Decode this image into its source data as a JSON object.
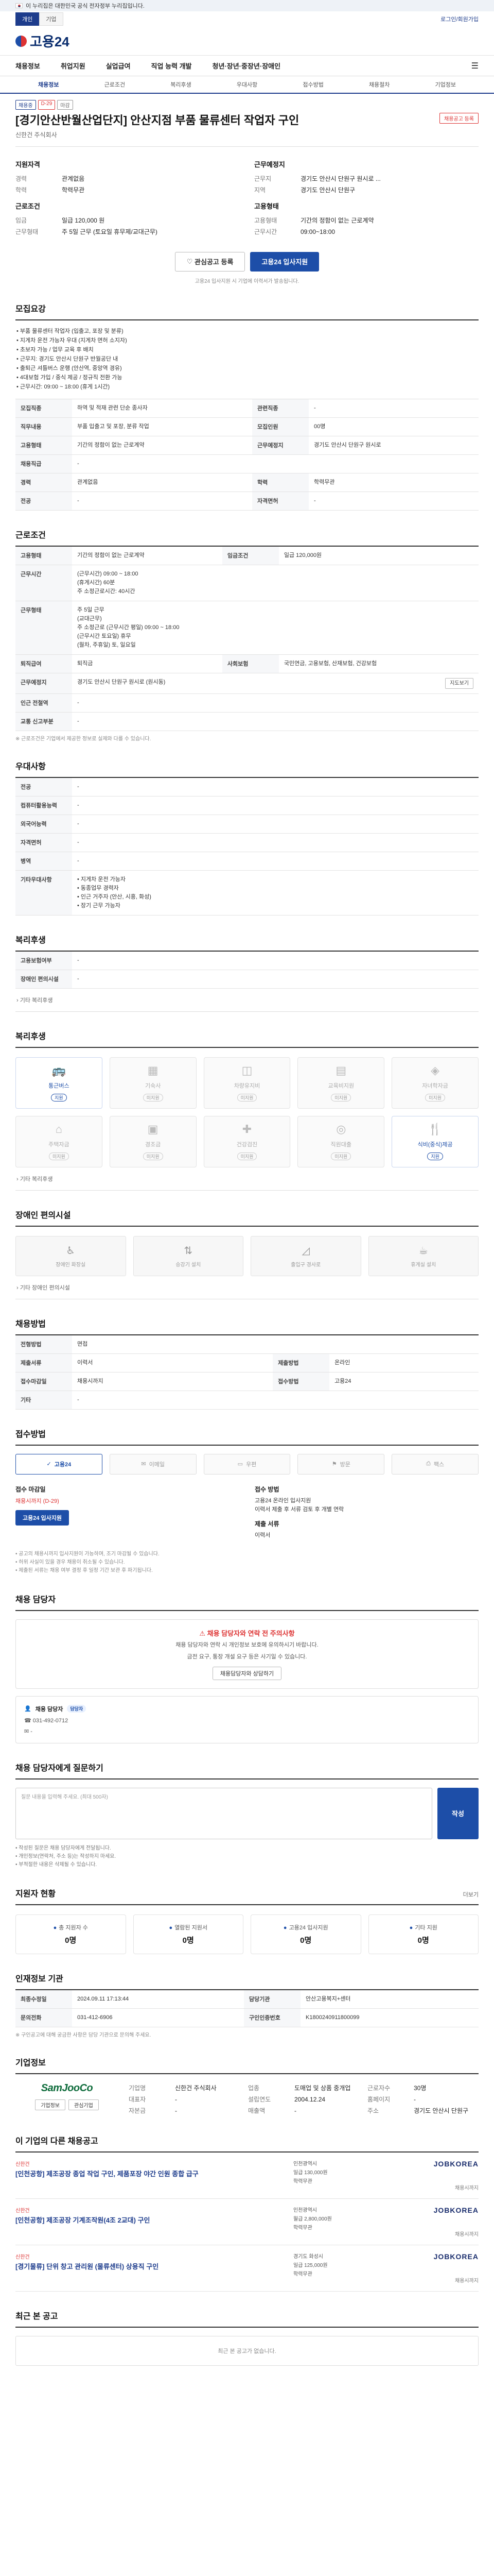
{
  "gov_banner": {
    "text": "이 누리집은 대한민국 공식 전자정부 누리집입니다."
  },
  "top_tabs": [
    "개인",
    "기업"
  ],
  "login_link": "로그인/회원가입",
  "logo_text": "고용24",
  "gnb": [
    "채용정보",
    "취업지원",
    "실업급여",
    "직업 능력 개발",
    "청년·장년·중장년·장애인"
  ],
  "subnav": [
    "채용정보",
    "근로조건",
    "복리후생",
    "우대사항",
    "접수방법",
    "채용절차",
    "기업정보"
  ],
  "job": {
    "tags": [
      "채용중",
      "D-29",
      "마감"
    ],
    "title": "[경기안산반월산업단지] 안산지점 부품 물류센터 작업자 구인",
    "register_btn": "채용공고 등록",
    "company": "신한건 주식회사"
  },
  "summary": {
    "left_title": "지원자격",
    "left": [
      {
        "k": "경력",
        "v": "관계없음"
      },
      {
        "k": "학력",
        "v": "학력무관"
      }
    ],
    "left_title2": "근로조건",
    "left2": [
      {
        "k": "임금",
        "v": "일급 120,000 원"
      },
      {
        "k": "근무형태",
        "v": "주 5일 근무 (토요일 휴무제/교대근무)"
      }
    ],
    "right_title": "근무예정지",
    "right": [
      {
        "k": "근무지",
        "v": "경기도 안산시 단원구 원시로 ..."
      },
      {
        "k": "지역",
        "v": "경기도 안산시 단원구"
      }
    ],
    "right_title2": "고용형태",
    "right2": [
      {
        "k": "고용형태",
        "v": "기간의 정함이 없는 근로계약"
      },
      {
        "k": "근무시간",
        "v": "09:00~18:00"
      }
    ]
  },
  "cta": {
    "scrap": "관심공고 등록",
    "apply": "고용24 입사지원"
  },
  "cta_note": "고용24 입사지원 시 기업에 이력서가 발송됩니다.",
  "recruit": {
    "title": "모집요강",
    "desc_label": "직무내용",
    "desc": "• 부품 물류센터 작업자 (입출고, 포장 및 분류)\n• 지게차 운전 가능자 우대 (지게차 면허 소지자)\n• 초보자 가능 / 업무 교육 후 배치\n• 근무지: 경기도 안산시 단원구 반월공단 내\n• 출퇴근 셔틀버스 운행 (안산역, 중앙역 경유)\n• 4대보험 가입 / 중식 제공 / 정규직 전환 가능\n• 근무시간: 09:00 ~ 18:00 (휴게 1시간)",
    "rows": [
      {
        "k": "모집직종",
        "v": "하역 및 적재 관련 단순 종사자",
        "k2": "관련직종",
        "v2": "-"
      },
      {
        "k": "직무내용",
        "v": "부품 입출고 및 포장, 분류 작업",
        "k2": "모집인원",
        "v2": "00명"
      },
      {
        "k": "고용형태",
        "v": "기간의 정함이 없는 근로계약",
        "k2": "근무예정지",
        "v2": "경기도 안산시 단원구 원시로"
      },
      {
        "k": "채용직급",
        "v": "-",
        "k2": "",
        "v2": ""
      },
      {
        "k": "경력",
        "v": "관계없음",
        "k2": "학력",
        "v2": "학력무관"
      },
      {
        "k": "전공",
        "v": "-",
        "k2": "자격면허",
        "v2": "-"
      }
    ]
  },
  "conditions": {
    "title": "근로조건",
    "rows": [
      {
        "k": "고용형태",
        "v": "기간의 정함이 없는 근로계약",
        "k2": "임금조건",
        "v2": "일급 120,000원"
      },
      {
        "k": "근무시간",
        "v": "(근무시간) 09:00 ~ 18:00\n(휴게시간) 60분\n주 소정근로시간: 40시간",
        "k2": "",
        "v2": ""
      },
      {
        "k": "근무형태",
        "v": "주 5일 근무\n(교대근무)\n주 소정근로 (근무시간 평일) 09:00 ~ 18:00\n(근무시간 토요일) 휴무\n(월차, 주휴일) 토, 일요일",
        "k2": "",
        "v2": ""
      },
      {
        "k": "퇴직급여",
        "v": "퇴직금",
        "k2": "사회보험",
        "v2": "국민연금, 고용보험, 산재보험, 건강보험"
      },
      {
        "k": "근무예정지",
        "v": "경기도 안산시 단원구 원시로 (원시동)",
        "k2": "",
        "v2": ""
      },
      {
        "k": "인근 전철역",
        "v": "-",
        "k2": "",
        "v2": ""
      },
      {
        "k": "교통 신고부분",
        "v": "-",
        "k2": "",
        "v2": ""
      }
    ],
    "map_btn": "지도보기",
    "note": "※ 근로조건은 기업에서 제공한 정보로 실제와 다를 수 있습니다."
  },
  "preferred": {
    "title": "우대사항",
    "rows": [
      {
        "k": "전공",
        "v": "-"
      },
      {
        "k": "컴퓨터활용능력",
        "v": "-"
      },
      {
        "k": "외국어능력",
        "v": "-"
      },
      {
        "k": "자격면허",
        "v": "-"
      },
      {
        "k": "병역",
        "v": "-"
      }
    ],
    "etc_label": "기타우대사항",
    "etc": "• 지게차 운전 가능자\n• 동종업무 경력자\n• 인근 거주자 (안산, 시흥, 화성)\n• 장기 근무 가능자"
  },
  "welfare": {
    "title": "복리후생",
    "rows": [
      {
        "k": "고용보험여부",
        "v": "-"
      },
      {
        "k": "장애인 편의시설",
        "v": "-"
      }
    ],
    "note": "기타 복리후생"
  },
  "insurance": {
    "title": "복리후생",
    "items": [
      {
        "label": "통근버스",
        "on": true
      },
      {
        "label": "기숙사",
        "on": false
      },
      {
        "label": "차량유지비",
        "on": false
      },
      {
        "label": "교육비지원",
        "on": false
      },
      {
        "label": "자녀학자금",
        "on": false
      },
      {
        "label": "주택자금",
        "on": false
      },
      {
        "label": "경조금",
        "on": false
      },
      {
        "label": "건강검진",
        "on": false
      },
      {
        "label": "직원대출",
        "on": false
      },
      {
        "label": "식비(중식)제공",
        "on": true
      }
    ],
    "status_on": "지원",
    "status_off": "미지원",
    "note": "기타 복리후생"
  },
  "disabled": {
    "title": "장애인 편의시설",
    "items": [
      "장애인 화장실",
      "승강기 설치",
      "출입구 경사로",
      "휴게실 설치"
    ],
    "note": "기타 장애인 편의시설"
  },
  "recruit_method": {
    "title": "채용방법",
    "rows": [
      {
        "k": "전형방법",
        "v": "면접",
        "k2": "",
        "v2": ""
      },
      {
        "k": "제출서류",
        "v": "이력서",
        "k2": "제출방법",
        "v2": "온라인"
      },
      {
        "k": "접수마감일",
        "v": "채용시까지",
        "k2": "접수방법",
        "v2": "고용24"
      },
      {
        "k": "기타",
        "v": "-",
        "k2": "",
        "v2": ""
      }
    ]
  },
  "apply": {
    "title": "접수방법",
    "methods": [
      {
        "label": "고용24",
        "on": true
      },
      {
        "label": "이메일",
        "on": false
      },
      {
        "label": "우편",
        "on": false
      },
      {
        "label": "방문",
        "on": false
      },
      {
        "label": "팩스",
        "on": false
      }
    ],
    "left_h": "접수 마감일",
    "left_sub": "채용시까지 (D-29)",
    "left_btn": "고용24 입사지원",
    "right_h": "접수 방법",
    "right_txt": "고용24 온라인 입사지원\n이력서 제출 후 서류 검토 후 개별 연락",
    "right_h2": "제출 서류",
    "right_txt2": "이력서",
    "notes": "• 공고의 채용시까지 입사지원이 가능하며, 조기 마감될 수 있습니다.\n• 허위 사실이 있을 경우 채용이 취소될 수 있습니다.\n• 제출된 서류는 채용 여부 결정 후 일정 기간 보관 후 파기됩니다."
  },
  "contact": {
    "title": "채용 담당자",
    "alert_title": "채용 담당자와 연락 전 주의사항",
    "alert_text": "채용 담당자와 연락 시 개인정보 보호에 유의하시기 바랍니다.",
    "alert_text2": "금전 요구, 통장 개설 요구 등은 사기일 수 있습니다.",
    "alert_btn": "채용담당자와 상담하기",
    "name": "채용 담당자",
    "badge": "담당자",
    "phone": "031-492-0712",
    "email": "-"
  },
  "question": {
    "title": "채용 담당자에게 질문하기",
    "placeholder": "질문 내용을 입력해 주세요. (최대 500자)",
    "send": "작성",
    "notes": "• 작성된 질문은 채용 담당자에게 전달됩니다.\n• 개인정보(연락처, 주소 등)는 작성하지 마세요.\n• 부적절한 내용은 삭제될 수 있습니다."
  },
  "stats": {
    "title": "지원자 현황",
    "more": "더보기",
    "items": [
      {
        "label": "총 지원자 수",
        "num": "0명"
      },
      {
        "label": "열람된 지원서",
        "num": "0명"
      },
      {
        "label": "고용24 입사지원",
        "num": "0명"
      },
      {
        "label": "기타 지원",
        "num": "0명"
      }
    ]
  },
  "agency": {
    "title": "인재정보 기관",
    "rows": [
      {
        "k": "최종수정일",
        "v": "2024.09.11 17:13:44",
        "k2": "담당기관",
        "v2": "안산고용복지+센터"
      },
      {
        "k": "문의전화",
        "v": "031-412-6906",
        "k2": "구인인증번호",
        "v2": "K1800240911800099"
      }
    ],
    "note": "※ 구인공고에 대해 궁금한 사항은 담당 기관으로 문의해 주세요."
  },
  "company": {
    "title": "기업정보",
    "logo": "SamJooCo",
    "btn1": "기업정보",
    "btn2": "관심기업",
    "rows": [
      {
        "k": "기업명",
        "v": "신한건 주식회사"
      },
      {
        "k": "업종",
        "v": "도매업 및 상품 중개업"
      },
      {
        "k": "근로자수",
        "v": "30명"
      },
      {
        "k": "대표자",
        "v": "-"
      },
      {
        "k": "설립연도",
        "v": "2004.12.24"
      },
      {
        "k": "홈페이지",
        "v": "-"
      },
      {
        "k": "자본금",
        "v": "-"
      },
      {
        "k": "매출액",
        "v": "-"
      },
      {
        "k": "주소",
        "v": "경기도 안산시 단원구"
      }
    ]
  },
  "related": {
    "title": "이 기업의 다른 채용공고",
    "posts": [
      {
        "co": "신한건",
        "t": "[인천공항] 제조공장 종업 작업 구인, 제품포장 야간 인원 종합 급구",
        "loc": "인천광역시",
        "pay": "일급 130,000원",
        "edu": "학력무관",
        "logo": "JOBKOREA"
      },
      {
        "co": "신한건",
        "t": "[인천공항] 제조공장 기계조작원(4조 2교대) 구인",
        "loc": "인천광역시",
        "pay": "월급 2,800,000원",
        "edu": "학력무관",
        "logo": "JOBKOREA"
      },
      {
        "co": "신한건",
        "t": "[경기물류] 단위 창고 관리원 (물류센터) 상용직 구인",
        "loc": "경기도 화성시",
        "pay": "일급 125,000원",
        "edu": "학력무관",
        "logo": "JOBKOREA"
      }
    ],
    "deadline": "채용시까지"
  },
  "recent": {
    "title": "최근 본 공고",
    "empty": "최근 본 공고가 없습니다."
  }
}
